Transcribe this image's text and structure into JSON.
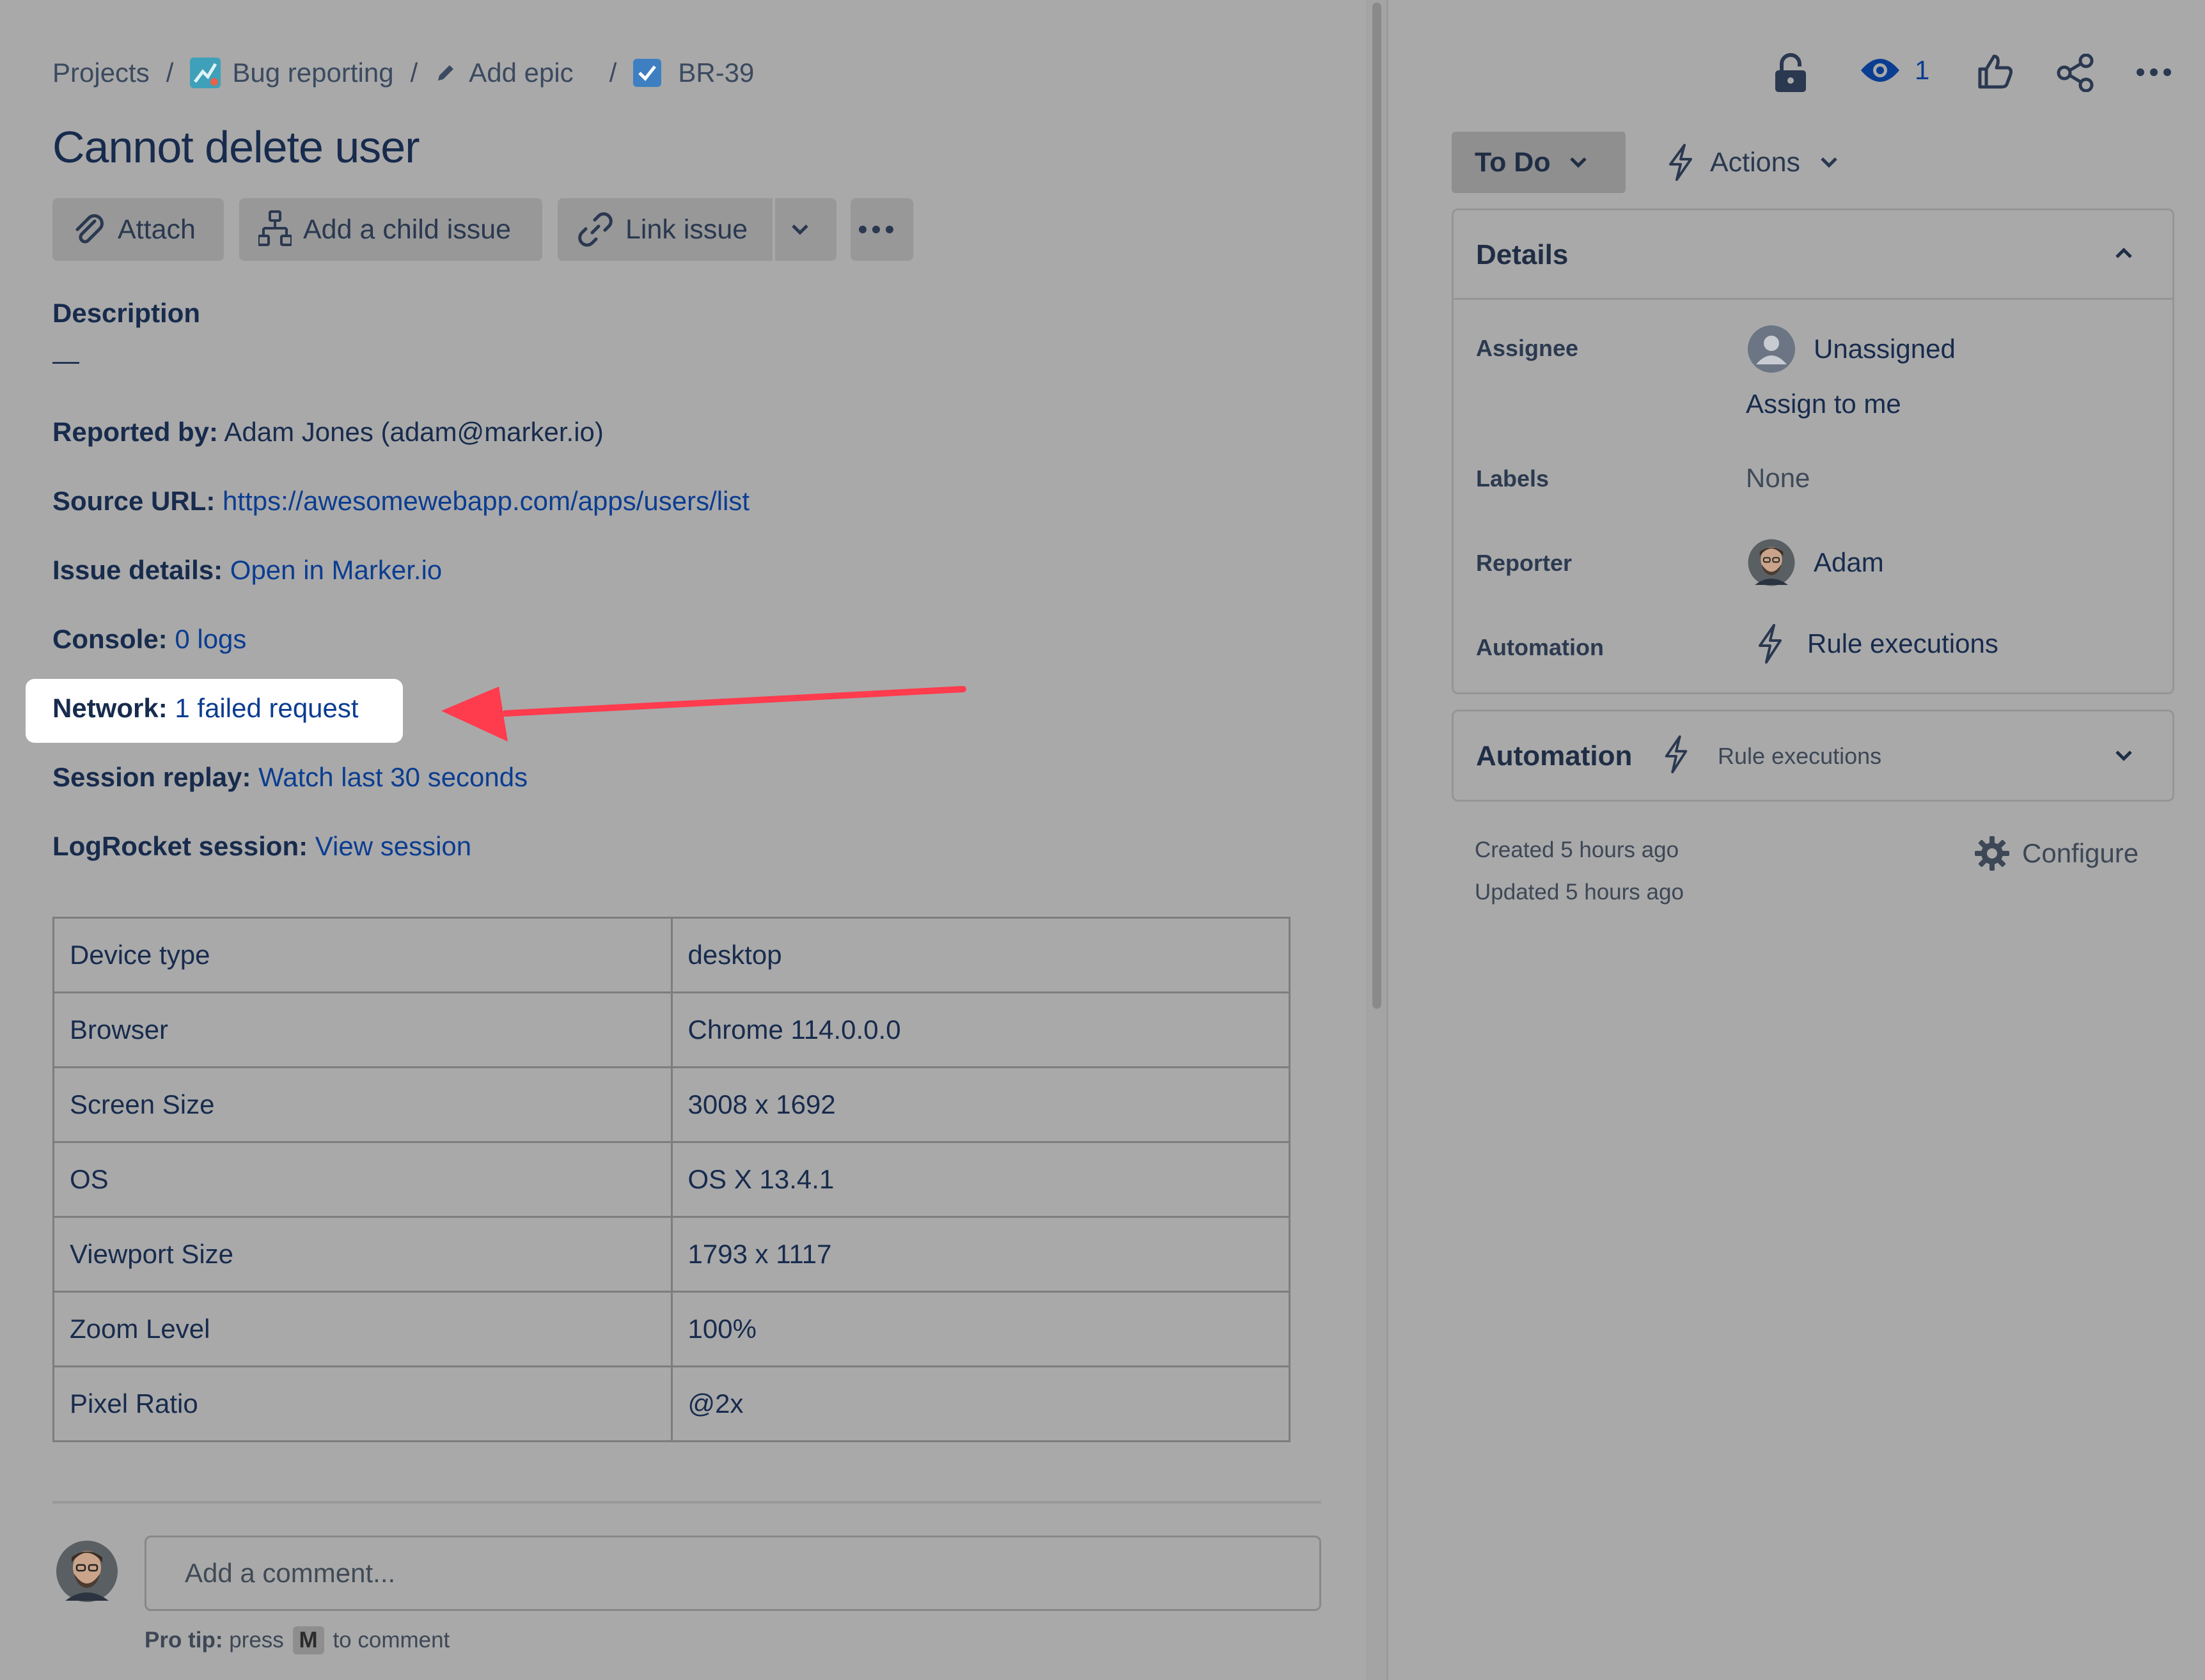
{
  "breadcrumb": {
    "projects": "Projects",
    "project": "Bug reporting",
    "epic": "Add epic",
    "issue_key": "BR-39",
    "separator": "/"
  },
  "issue": {
    "title": "Cannot delete user"
  },
  "toolbar": {
    "attach": "Attach",
    "add_child": "Add a child issue",
    "link_issue": "Link issue"
  },
  "description": {
    "label": "Description",
    "empty": "—",
    "fields": [
      {
        "label": "Reported by:",
        "value": "Adam Jones (adam@marker.io)"
      },
      {
        "label": "Source URL:",
        "value": "https://awesomewebapp.com/apps/users/list"
      },
      {
        "label": "Issue details:",
        "value": "Open in Marker.io"
      },
      {
        "label": "Console:",
        "value": "0 logs"
      },
      {
        "label": "Network:",
        "value": "1 failed request"
      },
      {
        "label": "Session replay:",
        "value": "Watch last 30 seconds"
      },
      {
        "label": "LogRocket session:",
        "value": "View session"
      }
    ]
  },
  "device_table": [
    [
      "Device type",
      "desktop"
    ],
    [
      "Browser",
      "Chrome 114.0.0.0"
    ],
    [
      "Screen Size",
      "3008 x 1692"
    ],
    [
      "OS",
      "OS X 13.4.1"
    ],
    [
      "Viewport Size",
      "1793 x 1117"
    ],
    [
      "Zoom Level",
      "100%"
    ],
    [
      "Pixel Ratio",
      "@2x"
    ]
  ],
  "comment": {
    "placeholder": "Add a comment...",
    "pro_tip_label": "Pro tip:",
    "pro_tip_press": "press",
    "pro_tip_key": "M",
    "pro_tip_suffix": "to comment"
  },
  "header_actions": {
    "watchers": "1"
  },
  "status": {
    "current": "To Do",
    "actions": "Actions"
  },
  "details": {
    "title": "Details",
    "assignee_label": "Assignee",
    "assignee_value": "Unassigned",
    "assign_to_me": "Assign to me",
    "labels_label": "Labels",
    "labels_value": "None",
    "reporter_label": "Reporter",
    "reporter_value": "Adam",
    "automation_label": "Automation",
    "automation_value": "Rule executions"
  },
  "automation_panel": {
    "title": "Automation",
    "subtitle": "Rule executions"
  },
  "meta": {
    "created": "Created 5 hours ago",
    "updated": "Updated 5 hours ago",
    "configure": "Configure"
  },
  "colors": {
    "link": "#0b3d91",
    "annotation_arrow": "#ff3b4e",
    "highlight": "#ffffff"
  }
}
